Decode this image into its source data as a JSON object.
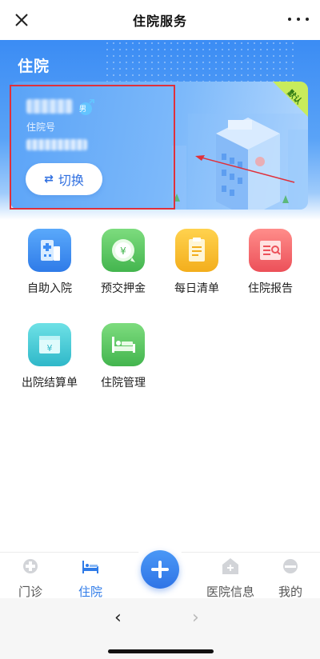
{
  "nav": {
    "title": "住院服务",
    "close_icon": "close-icon",
    "more_icon": "more-icon"
  },
  "hero": {
    "section_title": "住院",
    "card": {
      "inpatient_label": "住院号",
      "gender": "男",
      "switch_label": "切换",
      "switch_icon": "swap-icon",
      "corner_badge": "默认"
    }
  },
  "services": [
    {
      "label": "自助入院",
      "icon": "hospital-icon",
      "color": "#3b8cf4"
    },
    {
      "label": "预交押金",
      "icon": "deposit-icon",
      "color": "#4cc15a"
    },
    {
      "label": "每日清单",
      "icon": "list-icon",
      "color": "#f6b82a"
    },
    {
      "label": "住院报告",
      "icon": "report-icon",
      "color": "#f2646a"
    },
    {
      "label": "出院结算单",
      "icon": "settlement-icon",
      "color": "#3ec7d6"
    },
    {
      "label": "住院管理",
      "icon": "bed-icon",
      "color": "#4cc15a"
    }
  ],
  "tabbar": {
    "tabs": [
      {
        "label": "门诊",
        "icon": "outpatient-icon",
        "active": false
      },
      {
        "label": "住院",
        "icon": "bed-icon",
        "active": true
      },
      {
        "label": "医院信息",
        "icon": "hospital-info-icon",
        "active": false
      },
      {
        "label": "我的",
        "icon": "profile-icon",
        "active": false
      }
    ],
    "fab_icon": "plus-icon"
  },
  "browser": {
    "back_icon": "‹",
    "forward_icon": "›"
  },
  "colors": {
    "primary": "#2f7be8",
    "hero_blue": "#3b8cf4",
    "highlight_red": "#e0303a"
  }
}
